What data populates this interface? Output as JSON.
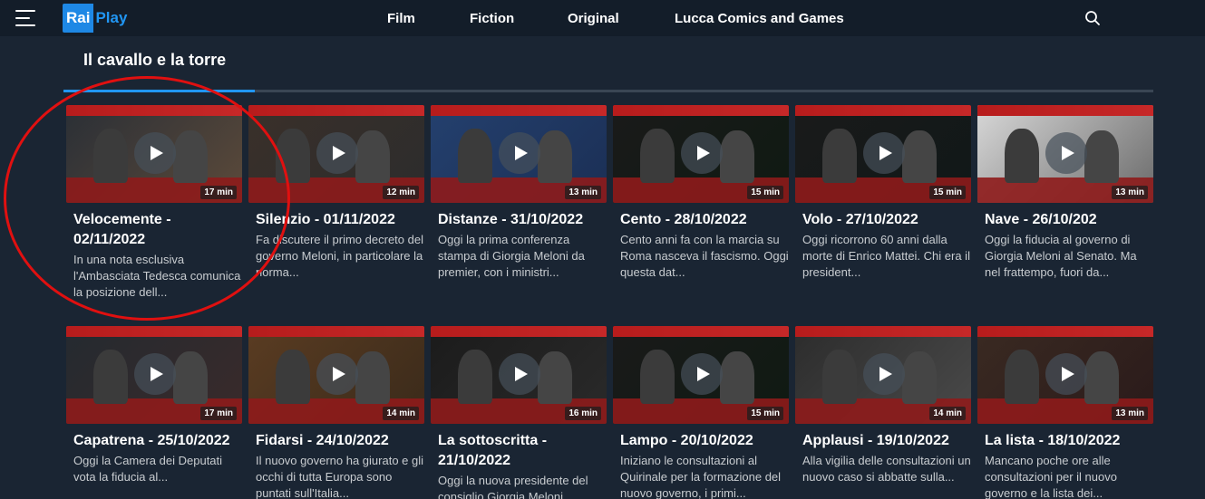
{
  "header": {
    "logo_rai": "Rai",
    "logo_play": "Play",
    "nav": [
      "Film",
      "Fiction",
      "Original",
      "Lucca Comics and Games"
    ]
  },
  "section": {
    "title": "Il cavallo e la torre"
  },
  "rows": [
    [
      {
        "title": "Velocemente - 02/11/2022",
        "desc": "In una nota esclusiva l'Ambasciata Tedesca comunica la posizione dell...",
        "duration": "17 min"
      },
      {
        "title": "Silenzio - 01/11/2022",
        "desc": "Fa discutere il primo decreto del governo Meloni, in particolare la norma...",
        "duration": "12 min"
      },
      {
        "title": "Distanze - 31/10/2022",
        "desc": "Oggi la prima conferenza stampa di Giorgia Meloni da premier, con i ministri...",
        "duration": "13 min"
      },
      {
        "title": "Cento - 28/10/2022",
        "desc": "Cento anni fa con la marcia su Roma nasceva il fascismo. Oggi questa dat...",
        "duration": "15 min"
      },
      {
        "title": "Volo - 27/10/2022",
        "desc": "Oggi ricorrono 60 anni dalla morte di Enrico Mattei. Chi era il president...",
        "duration": "15 min"
      },
      {
        "title": "Nave - 26/10/202",
        "desc": "Oggi la fiducia al governo di Giorgia Meloni al Senato. Ma nel frattempo, fuori da...",
        "duration": "13 min"
      }
    ],
    [
      {
        "title": "Capatrena - 25/10/2022",
        "desc": "Oggi la Camera dei Deputati vota la fiducia al...",
        "duration": "17 min"
      },
      {
        "title": "Fidarsi - 24/10/2022",
        "desc": "Il nuovo governo ha giurato e gli occhi di tutta Europa sono puntati sull'Italia...",
        "duration": "14 min"
      },
      {
        "title": "La sottoscritta - 21/10/2022",
        "desc": "Oggi la nuova presidente del consiglio Giorgia Meloni...",
        "duration": "16 min"
      },
      {
        "title": "Lampo - 20/10/2022",
        "desc": "Iniziano le consultazioni al Quirinale per la formazione del nuovo governo, i primi...",
        "duration": "15 min"
      },
      {
        "title": "Applausi - 19/10/2022",
        "desc": "Alla vigilia delle consultazioni un nuovo caso si abbatte sulla...",
        "duration": "14 min"
      },
      {
        "title": "La lista - 18/10/2022",
        "desc": "Mancano poche ore alle consultazioni per il nuovo governo e la lista dei...",
        "duration": "13 min"
      }
    ]
  ],
  "colors": {
    "accent": "#2196f3",
    "background": "#1a2533",
    "annotation": "#e01010"
  }
}
